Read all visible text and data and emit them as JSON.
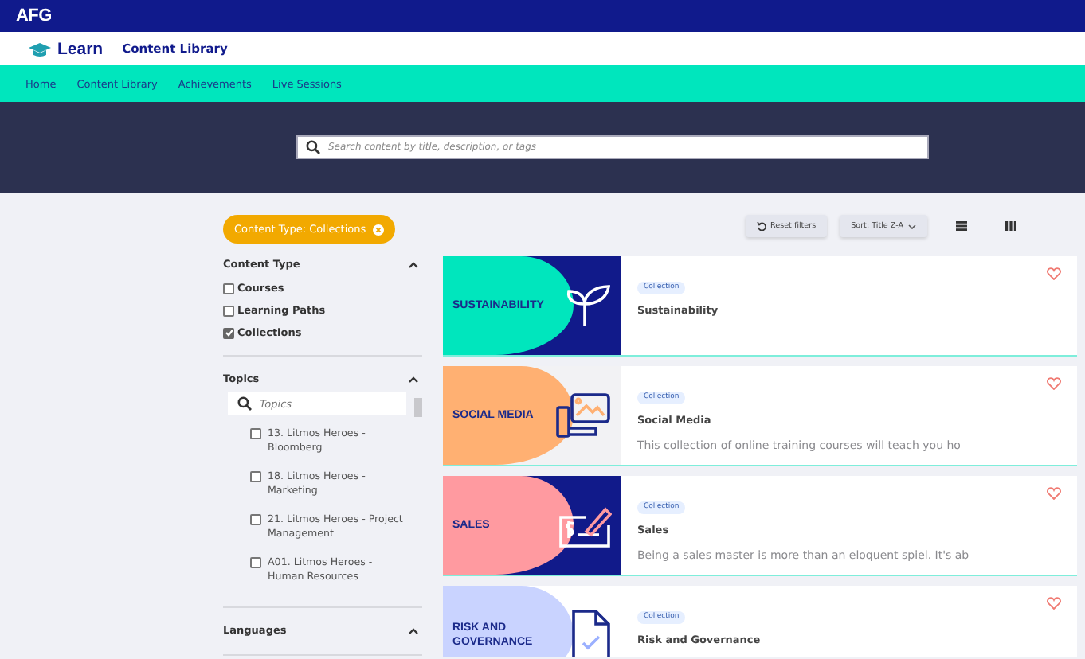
{
  "brand": {
    "logo": "AFG"
  },
  "header": {
    "app_name": "Learn",
    "page_title": "Content Library"
  },
  "nav": [
    {
      "label": "Home"
    },
    {
      "label": "Content Library"
    },
    {
      "label": "Achievements"
    },
    {
      "label": "Live Sessions"
    }
  ],
  "search": {
    "placeholder": "Search content by title, description, or tags"
  },
  "active_filter": {
    "label": "Content Type: Collections"
  },
  "toolbar": {
    "reset": "Reset filters",
    "sort": "Sort: Title Z-A"
  },
  "filters": [
    {
      "title": "Content Type",
      "expanded": true,
      "options": [
        {
          "label": "Courses",
          "checked": false
        },
        {
          "label": "Learning Paths",
          "checked": false
        },
        {
          "label": "Collections",
          "checked": true
        }
      ]
    },
    {
      "title": "Topics",
      "expanded": true,
      "placeholder": "Topics",
      "options": [
        {
          "label": "13. Litmos Heroes - Bloomberg",
          "checked": false
        },
        {
          "label": "18. Litmos Heroes - Marketing",
          "checked": false
        },
        {
          "label": "21. Litmos Heroes - Project Management",
          "checked": false
        },
        {
          "label": "A01. Litmos Heroes - Human Resources",
          "checked": false
        }
      ]
    },
    {
      "title": "Languages",
      "expanded": true
    }
  ],
  "cards": [
    {
      "kind": "leaf",
      "banner": "SUSTAINABILITY",
      "color": "#00e6bd",
      "tag": "Collection",
      "title": "Sustainability"
    },
    {
      "kind": "monitor",
      "banner": "SOCIAL MEDIA",
      "color": "#ffb072",
      "tag": "Collection",
      "title": "Social Media",
      "description": "This collection of online training courses will teach you ho"
    },
    {
      "kind": "cheque",
      "banner": "SALES",
      "color": "#ff9aa0",
      "tag": "Collection",
      "title": "Sales",
      "description": "Being a sales master is more than an eloquent spiel. It's ab"
    },
    {
      "kind": "document",
      "banner": "RISK AND GOVERNANCE",
      "color": "#c9d3ff",
      "tag": "Collection",
      "title": "Risk and Governance"
    }
  ]
}
